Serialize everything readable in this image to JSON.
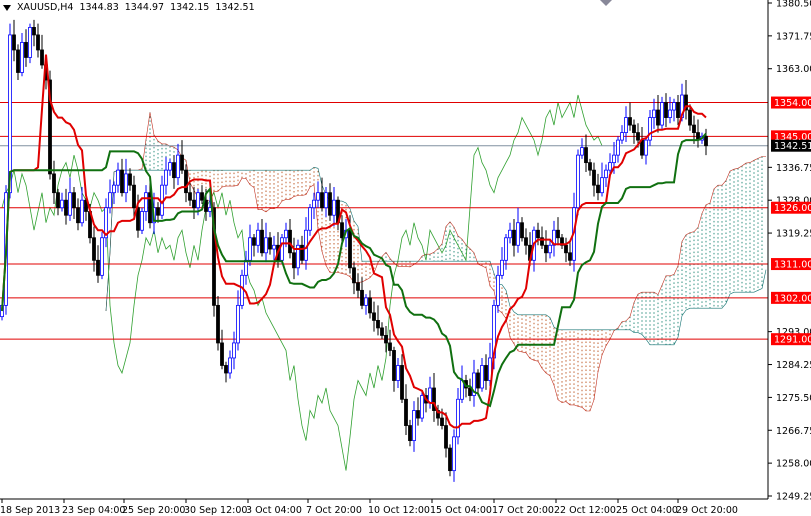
{
  "header": {
    "symbol": "XAUUSD,H4",
    "open": "1344.83",
    "high": "1344.97",
    "low": "1342.15",
    "close": "1342.51"
  },
  "chart_data": {
    "type": "candlestick",
    "title": "XAUUSD,H4",
    "timeframe": "H4",
    "ylim": [
      1249.25,
      1380.5
    ],
    "y_ticks": [
      "1380.50",
      "1371.75",
      "1363.00",
      "1336.75",
      "1328.00",
      "1319.25",
      "1293.00",
      "1284.25",
      "1275.50",
      "1266.75",
      "1258.00",
      "1249.25"
    ],
    "x_ticks": [
      "18 Sep 2013",
      "23 Sep 04:00",
      "25 Sep 20:00",
      "30 Sep 12:00",
      "3 Oct 04:00",
      "7 Oct 20:00",
      "10 Oct 12:00",
      "15 Oct 04:00",
      "17 Oct 20:00",
      "22 Oct 12:00",
      "25 Oct 04:00",
      "29 Oct 20:00"
    ],
    "closes": [
      1300,
      1330,
      1372,
      1368,
      1362,
      1370,
      1366,
      1374,
      1372,
      1368,
      1364,
      1360,
      1335,
      1330,
      1326,
      1328,
      1324,
      1330,
      1326,
      1322,
      1328,
      1325,
      1318,
      1312,
      1308,
      1318,
      1326,
      1330,
      1332,
      1336,
      1330,
      1335,
      1332,
      1326,
      1320,
      1325,
      1330,
      1322,
      1326,
      1324,
      1332,
      1336,
      1338,
      1334,
      1340,
      1336,
      1330,
      1328,
      1326,
      1330,
      1328,
      1325,
      1326,
      1300,
      1290,
      1284,
      1282,
      1286,
      1290,
      1300,
      1308,
      1312,
      1318,
      1316,
      1320,
      1314,
      1318,
      1315,
      1316,
      1312,
      1318,
      1320,
      1314,
      1310,
      1316,
      1312,
      1320,
      1326,
      1328,
      1330,
      1326,
      1330,
      1324,
      1328,
      1322,
      1318,
      1320,
      1310,
      1306,
      1304,
      1300,
      1302,
      1298,
      1296,
      1294,
      1292,
      1290,
      1288,
      1280,
      1284,
      1275,
      1268,
      1264,
      1272,
      1270,
      1276,
      1274,
      1278,
      1272,
      1270,
      1268,
      1262,
      1256,
      1265,
      1275,
      1280,
      1278,
      1276,
      1282,
      1278,
      1284,
      1280,
      1286,
      1300,
      1308,
      1312,
      1318,
      1320,
      1316,
      1322,
      1318,
      1316,
      1312,
      1320,
      1318,
      1316,
      1314,
      1316,
      1320,
      1318,
      1316,
      1314,
      1312,
      1326,
      1340,
      1342,
      1338,
      1336,
      1332,
      1330,
      1334,
      1336,
      1338,
      1340,
      1344,
      1346,
      1350,
      1348,
      1346,
      1344,
      1340,
      1344,
      1350,
      1352,
      1348,
      1354,
      1350,
      1352,
      1354,
      1350,
      1356,
      1352,
      1348,
      1346,
      1344,
      1345,
      1342.51
    ],
    "indicators": "Ichimoku Kinko Hyo (tenkan red, kijun green, cloud dotted)",
    "horizontal_levels": [
      "1354.00",
      "1345.00",
      "1326.00",
      "1311.00",
      "1302.00",
      "1291.00"
    ],
    "current_price": "1342.51",
    "colors": {
      "bull": "#0000ff",
      "bear": "#000000",
      "level": "#e00000",
      "tenkan": "#e00000",
      "kijun": "#107010",
      "cloud_up": "#c06030",
      "cloud_down": "#309080"
    }
  }
}
